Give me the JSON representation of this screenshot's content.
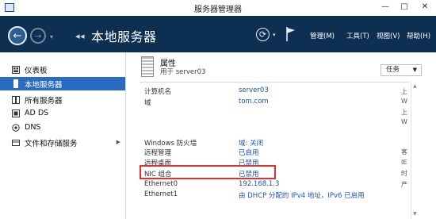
{
  "window": {
    "title": "服务器管理器",
    "min_glyph": "—",
    "max_glyph": "□",
    "close_glyph": "✕"
  },
  "toolbar": {
    "breadcrumb_sep": "◂◂",
    "breadcrumb": "本地服务器",
    "menus": [
      "管理(M)",
      "工具(T)",
      "视图(V)",
      "帮助(H)"
    ]
  },
  "sidebar": {
    "items": [
      {
        "label": "仪表板",
        "icon": "dashboard-icon",
        "active": false
      },
      {
        "label": "本地服务器",
        "icon": "server-icon",
        "active": true
      },
      {
        "label": "所有服务器",
        "icon": "servers-icon",
        "active": false
      },
      {
        "label": "AD DS",
        "icon": "ad-ds-icon",
        "active": false
      },
      {
        "label": "DNS",
        "icon": "dns-icon",
        "active": false
      },
      {
        "label": "文件和存储服务",
        "icon": "file-storage-icon",
        "active": false,
        "expandable": true
      }
    ]
  },
  "properties": {
    "title": "属性",
    "subtitle": "用于 server03",
    "tasks_label": "任务",
    "rows": [
      {
        "label": "计算机名",
        "value": "server03"
      },
      {
        "label": "域",
        "value": "tom.com"
      },
      {
        "label": "Windows 防火墙",
        "value": "域: 关闭"
      },
      {
        "label": "远程管理",
        "value": "已启用"
      },
      {
        "label": "远程桌面",
        "value": "已禁用"
      },
      {
        "label": "NIC 组合",
        "value": "已禁用"
      },
      {
        "label": "Ethernet0",
        "value": "192.168.1.3"
      },
      {
        "label": "Ethernet1",
        "value": "由 DHCP 分配的 IPv4 地址，IPv6 已启用"
      }
    ],
    "right_truncated": [
      "上",
      "W",
      "上",
      "W",
      "客",
      "IE",
      "时",
      "产"
    ]
  },
  "colors": {
    "toolbar_bg": "#0d2f52",
    "active_item": "#2a6cc1",
    "link_value": "#1a55b5",
    "highlight_border": "#e03030"
  }
}
